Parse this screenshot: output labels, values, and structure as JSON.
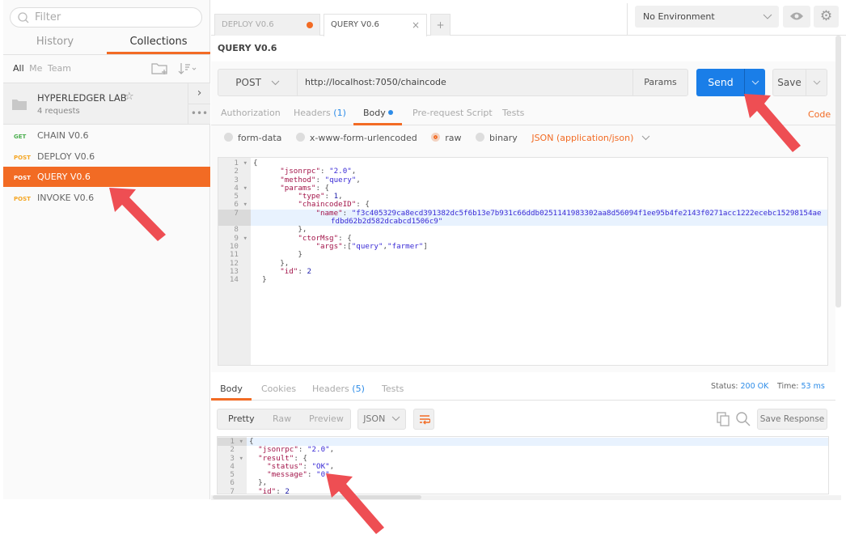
{
  "sidebar": {
    "filter_placeholder": "Filter",
    "tabs": [
      "History",
      "Collections"
    ],
    "owners": [
      "All",
      "Me",
      "Team"
    ],
    "collection": {
      "name": "HYPERLEDGER LAB",
      "count": "4 requests"
    },
    "items": [
      {
        "method": "GET",
        "name": "CHAIN V0.6",
        "method_color": "#4caf50"
      },
      {
        "method": "POST",
        "name": "DEPLOY V0.6",
        "method_color": "#f5a623"
      },
      {
        "method": "POST",
        "name": "QUERY V0.6",
        "method_color": "#ffffff",
        "selected": true
      },
      {
        "method": "POST",
        "name": "INVOKE V0.6",
        "method_color": "#f5a623"
      }
    ]
  },
  "tabs": [
    {
      "label": "DEPLOY V0.6",
      "unsaved": true
    },
    {
      "label": "QUERY V0.6",
      "active": true
    }
  ],
  "environment": "No Environment",
  "request": {
    "title": "QUERY V0.6",
    "method": "POST",
    "url": "http://localhost:7050/chaincode",
    "params_label": "Params",
    "send_label": "Send",
    "save_label": "Save",
    "tabs": [
      "Authorization",
      "Headers",
      "Body",
      "Pre-request Script",
      "Tests"
    ],
    "headers_count": "(1)",
    "code_label": "Code",
    "body_modes": [
      "form-data",
      "x-www-form-urlencoded",
      "raw",
      "binary"
    ],
    "content_type": "JSON (application/json)",
    "body_lines": [
      "{",
      "      \"jsonrpc\": \"2.0\",",
      "      \"method\": \"query\",",
      "      \"params\": {",
      "          \"type\": 1,",
      "          \"chaincodeID\": {",
      "              \"name\": \"f3c405329ca8ecd391382dc5f6b13e7b931c66ddb0251141983302aa8d56094f1ee95b4fe2143f0271acc1222ecebc15298154aefdbd62b2d582dcabcd1506c9\"",
      "          },",
      "          \"ctorMsg\": {",
      "              \"args\":[\"query\",\"farmer\"]",
      "          }",
      "      },",
      "      \"id\": 2",
      "  }"
    ]
  },
  "response": {
    "tabs": [
      "Body",
      "Cookies",
      "Headers",
      "Tests"
    ],
    "headers_count": "(5)",
    "status_label": "Status:",
    "status": "200 OK",
    "time_label": "Time:",
    "time": "53 ms",
    "views": [
      "Pretty",
      "Raw",
      "Preview"
    ],
    "format": "JSON",
    "save_response": "Save Response",
    "body_lines": [
      "{",
      "  \"jsonrpc\": \"2.0\",",
      "  \"result\": {",
      "    \"status\": \"OK\",",
      "    \"message\": \"0\"",
      "  },",
      "  \"id\": 2"
    ]
  },
  "colors": {
    "accent": "#f26b24",
    "send": "#1a7ee8",
    "link": "#2d8ce8",
    "arrow": "#ee4e53"
  }
}
